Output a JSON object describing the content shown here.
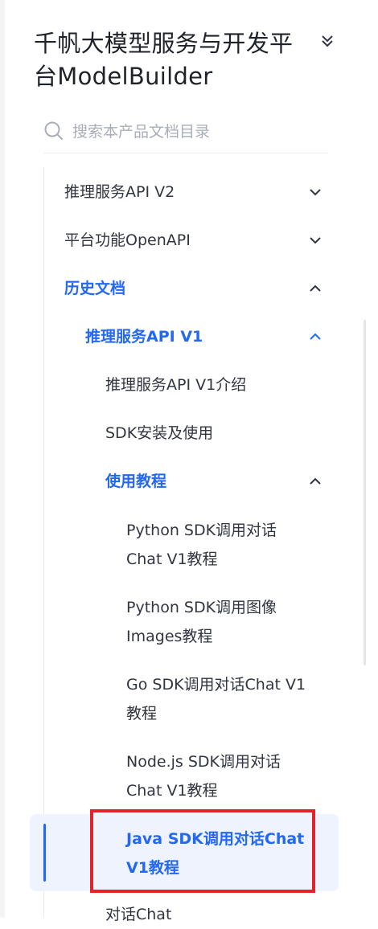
{
  "header": {
    "title": "千帆大模型服务与开发平台ModelBuilder",
    "collapse_icon": "chevron-double-down-icon"
  },
  "search": {
    "placeholder": "搜索本产品文档目录",
    "value": "",
    "icon": "search-icon"
  },
  "nav": {
    "item_0": "推理服务API V2",
    "item_1": "平台功能OpenAPI",
    "item_2": "历史文档",
    "item_3": "推理服务API V1",
    "item_4": "推理服务API V1介绍",
    "item_5": "SDK安装及使用",
    "item_6": "使用教程",
    "item_7": "Python SDK调用对话Chat V1教程",
    "item_8": "Python SDK调用图像Images教程",
    "item_9": "Go SDK调用对话Chat V1教程",
    "item_10": "Node.js SDK调用对话Chat V1教程",
    "item_11": "Java SDK调用对话Chat V1教程",
    "item_12": "对话Chat"
  },
  "colors": {
    "accent": "#2468f2",
    "active_background": "#eef3fd",
    "annotation_red": "#e5222a",
    "text": "#303540"
  }
}
